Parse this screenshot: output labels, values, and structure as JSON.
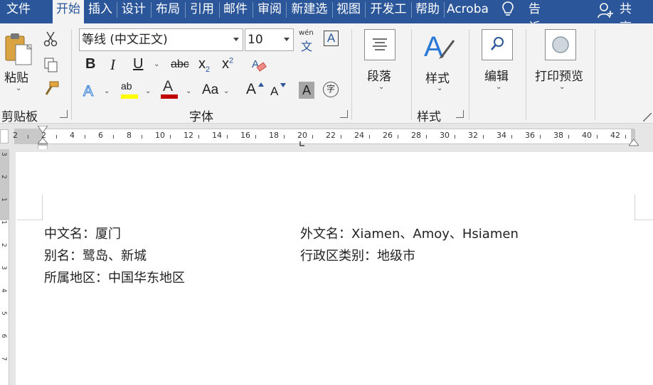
{
  "tabs": [
    {
      "label": "文件",
      "active": false
    },
    {
      "label": "开始",
      "active": true
    },
    {
      "label": "插入",
      "active": false
    },
    {
      "label": "设计",
      "active": false
    },
    {
      "label": "布局",
      "active": false
    },
    {
      "label": "引用",
      "active": false
    },
    {
      "label": "邮件",
      "active": false
    },
    {
      "label": "审阅",
      "active": false
    },
    {
      "label": "新建选",
      "active": false
    },
    {
      "label": "视图",
      "active": false
    },
    {
      "label": "开发工",
      "active": false
    },
    {
      "label": "帮助",
      "active": false
    },
    {
      "label": "Acrobat",
      "active": false
    }
  ],
  "tellme": {
    "label": "告诉我"
  },
  "share": {
    "label": "共享"
  },
  "clipboard": {
    "paste_label": "粘贴",
    "group_label": "剪贴板"
  },
  "font": {
    "font_name": "等线 (中文正文)",
    "font_size": "10",
    "phonetic_top": "wén",
    "phonetic_bottom": "文",
    "border_char": "A",
    "bold": "B",
    "italic": "I",
    "underline": "U",
    "strike": "abc",
    "subscript": "x",
    "subscript_sub": "2",
    "superscript": "x",
    "superscript_sup": "2",
    "text_effect": "A",
    "highlight": "ab",
    "font_color": "A",
    "change_case": "Aa",
    "grow": "A",
    "shrink": "A",
    "char_shade": "A",
    "enclose": "字",
    "group_label": "字体"
  },
  "paragraph": {
    "label": "段落"
  },
  "styles": {
    "label": "样式",
    "group_label": "样式"
  },
  "editing": {
    "label": "编辑"
  },
  "print_preview": {
    "label": "打印预览"
  },
  "ruler": {
    "numbers": [
      "2",
      "2",
      "4",
      "6",
      "8",
      "10",
      "12",
      "14",
      "16",
      "18",
      "20",
      "22",
      "24",
      "26",
      "28",
      "30",
      "32",
      "34",
      "36",
      "38",
      "40",
      "42"
    ]
  },
  "vruler": {
    "numbers": [
      "3",
      "2",
      "1",
      "1",
      "2",
      "3",
      "4",
      "5",
      "6",
      "7"
    ]
  },
  "document": {
    "line1_left": "中文名：厦门",
    "line1_right": "外文名：Xiamen、Amoy、Hsiamen",
    "line2_left": "别名：鹭岛、新城",
    "line2_right": "行政区类别：地级市",
    "line3_left": "所属地区：中国华东地区"
  },
  "colors": {
    "accent": "#2b579a",
    "highlight": "#ffff00",
    "font_color": "#c00000"
  }
}
